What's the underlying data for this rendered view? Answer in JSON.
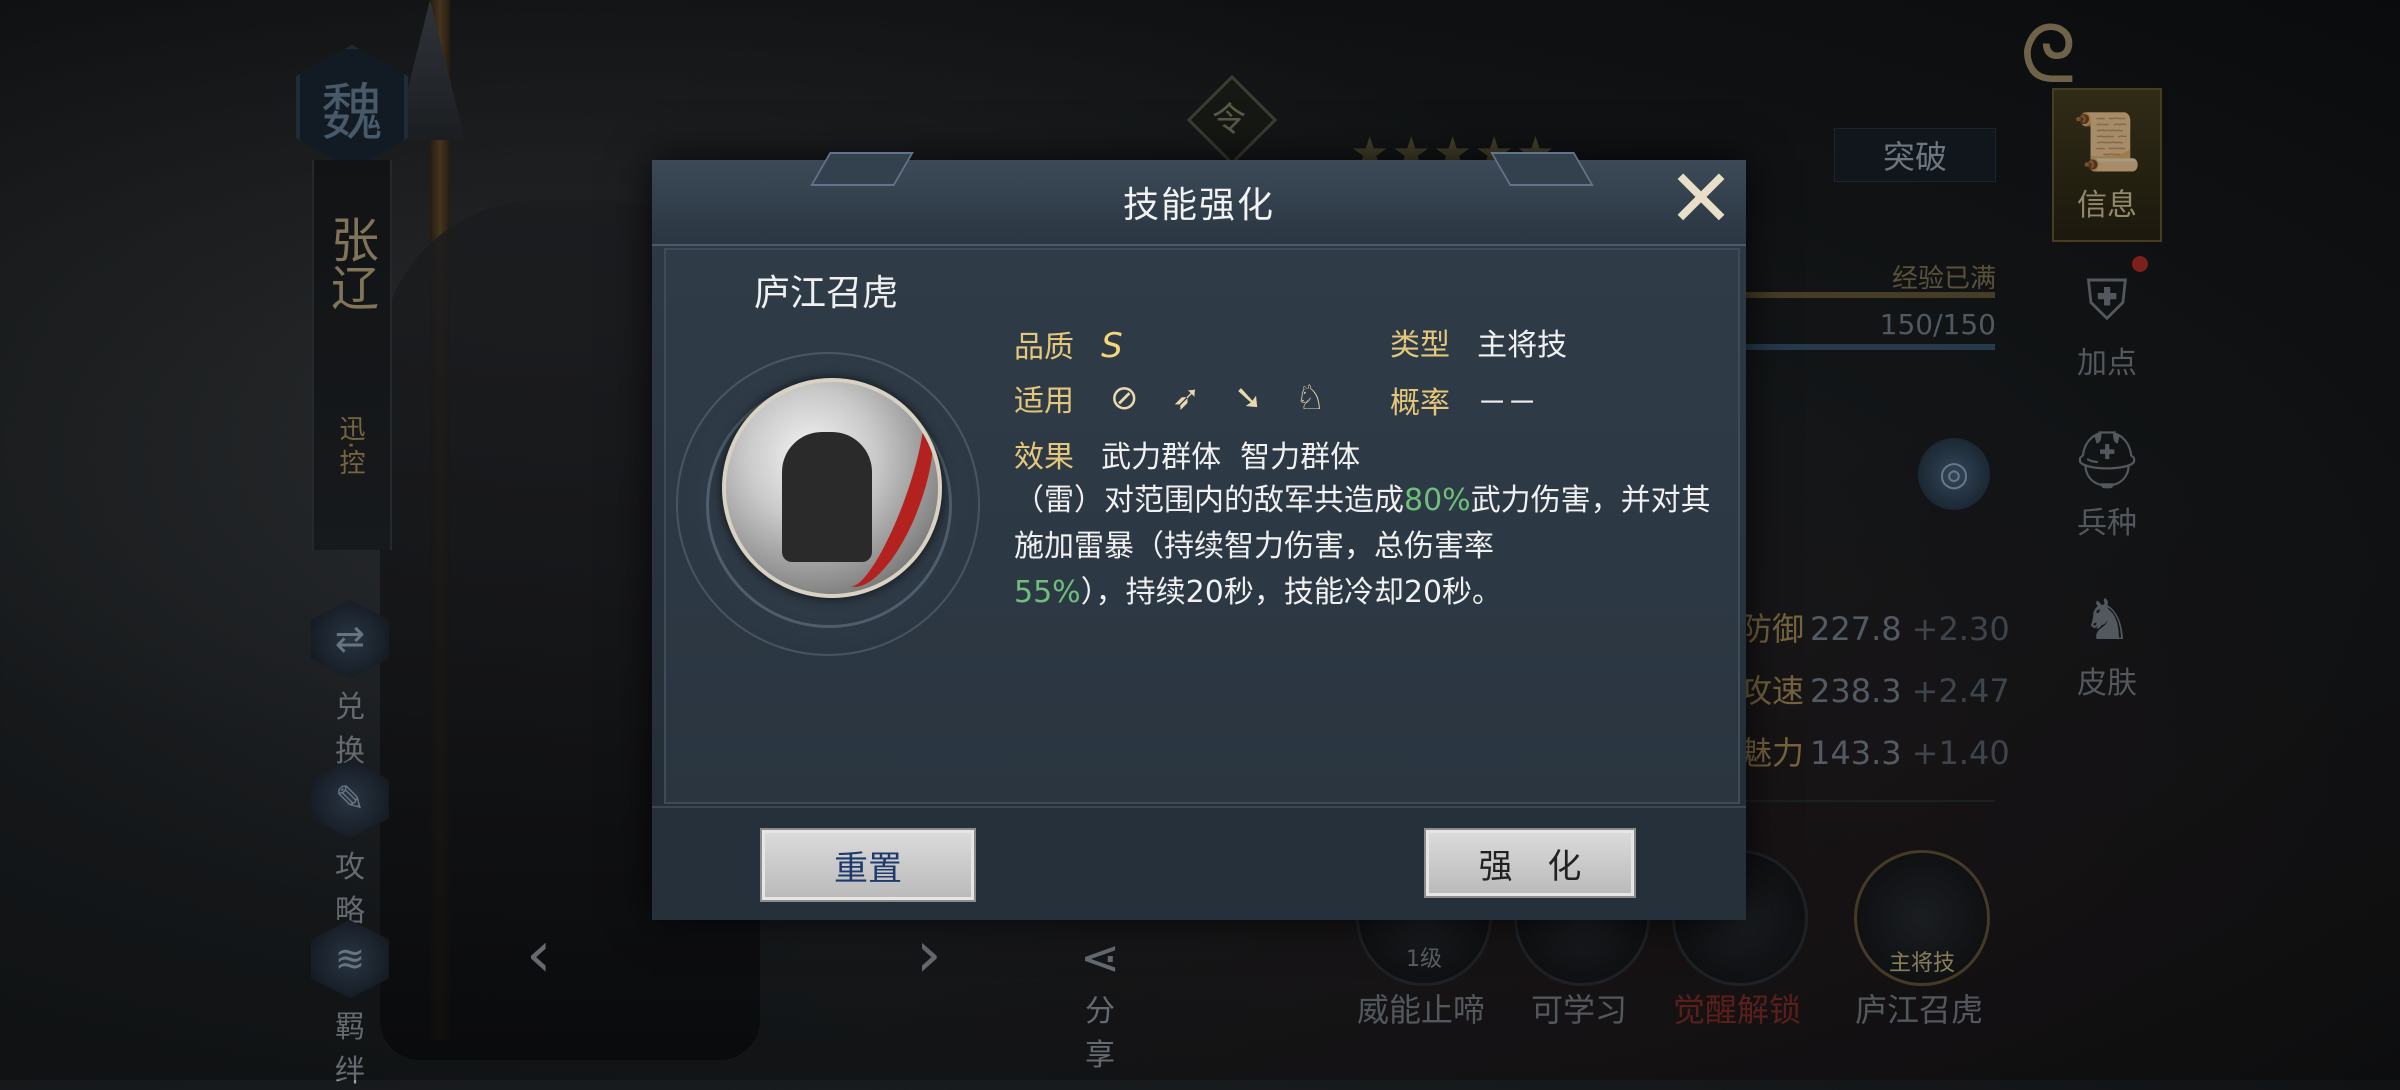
{
  "background": {
    "faction": "魏",
    "hero_name": "张辽",
    "hero_tag": "迅·控",
    "side_buttons": [
      "兑 换",
      "攻 略",
      "羁 绊"
    ],
    "share_label": "分 享",
    "ling_mark": "令",
    "stars": "★★★★★",
    "breakthrough_label": "突破",
    "exp_full_label": "经验已满",
    "exp_value": "150/150",
    "right_menu": [
      "信息",
      "加点",
      "兵种",
      "皮肤"
    ],
    "stats": [
      {
        "name": "防御",
        "value": "227.8",
        "inc": "+2.30"
      },
      {
        "name": "攻速",
        "value": "238.3",
        "inc": "+2.47"
      },
      {
        "name": "魅力",
        "value": "143.3",
        "inc": "+1.40"
      }
    ],
    "skills": [
      {
        "label": "威能止啼",
        "badge": "1级"
      },
      {
        "label": "可学习",
        "badge": ""
      },
      {
        "label": "觉醒解锁",
        "badge": ""
      },
      {
        "label": "庐江召虎",
        "badge": "主将技"
      }
    ]
  },
  "dialog": {
    "title": "技能强化",
    "skill_name": "庐江召虎",
    "quality_label": "品质",
    "quality_value": "S",
    "type_label": "类型",
    "type_value": "主将技",
    "apply_label": "适用",
    "apply_icons": [
      "shield-unit-icon",
      "archer-unit-icon",
      "spear-unit-icon",
      "cavalry-unit-icon"
    ],
    "chance_label": "概率",
    "chance_value": "－－",
    "effect_label": "效果",
    "effect_value": "武力群体  智力群体",
    "desc_part1": "（雷）对范围内的敌军共造成",
    "desc_pct1": "80%",
    "desc_part2": "武力伤害，并对其施加雷暴（持续智力伤害，总伤害率",
    "desc_pct2": "55%",
    "desc_part3": "），持续20秒，技能冷却20秒。",
    "reset_label": "重置",
    "strengthen_label": "强 化"
  },
  "colors": {
    "accent_gold": "#e4c77a",
    "highlight_green": "#6fbf7a",
    "button_text_blue": "#1e3a6a"
  }
}
